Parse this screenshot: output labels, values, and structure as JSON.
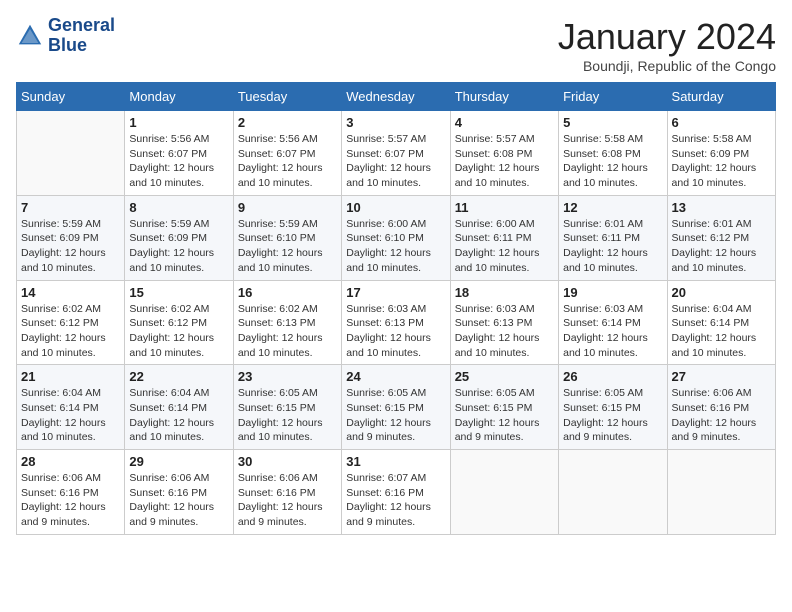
{
  "header": {
    "logo_line1": "General",
    "logo_line2": "Blue",
    "title": "January 2024",
    "subtitle": "Boundji, Republic of the Congo"
  },
  "days_of_week": [
    "Sunday",
    "Monday",
    "Tuesday",
    "Wednesday",
    "Thursday",
    "Friday",
    "Saturday"
  ],
  "weeks": [
    [
      {
        "day": "",
        "sunrise": "",
        "sunset": "",
        "daylight": ""
      },
      {
        "day": "1",
        "sunrise": "Sunrise: 5:56 AM",
        "sunset": "Sunset: 6:07 PM",
        "daylight": "Daylight: 12 hours and 10 minutes."
      },
      {
        "day": "2",
        "sunrise": "Sunrise: 5:56 AM",
        "sunset": "Sunset: 6:07 PM",
        "daylight": "Daylight: 12 hours and 10 minutes."
      },
      {
        "day": "3",
        "sunrise": "Sunrise: 5:57 AM",
        "sunset": "Sunset: 6:07 PM",
        "daylight": "Daylight: 12 hours and 10 minutes."
      },
      {
        "day": "4",
        "sunrise": "Sunrise: 5:57 AM",
        "sunset": "Sunset: 6:08 PM",
        "daylight": "Daylight: 12 hours and 10 minutes."
      },
      {
        "day": "5",
        "sunrise": "Sunrise: 5:58 AM",
        "sunset": "Sunset: 6:08 PM",
        "daylight": "Daylight: 12 hours and 10 minutes."
      },
      {
        "day": "6",
        "sunrise": "Sunrise: 5:58 AM",
        "sunset": "Sunset: 6:09 PM",
        "daylight": "Daylight: 12 hours and 10 minutes."
      }
    ],
    [
      {
        "day": "7",
        "sunrise": "Sunrise: 5:59 AM",
        "sunset": "Sunset: 6:09 PM",
        "daylight": "Daylight: 12 hours and 10 minutes."
      },
      {
        "day": "8",
        "sunrise": "Sunrise: 5:59 AM",
        "sunset": "Sunset: 6:09 PM",
        "daylight": "Daylight: 12 hours and 10 minutes."
      },
      {
        "day": "9",
        "sunrise": "Sunrise: 5:59 AM",
        "sunset": "Sunset: 6:10 PM",
        "daylight": "Daylight: 12 hours and 10 minutes."
      },
      {
        "day": "10",
        "sunrise": "Sunrise: 6:00 AM",
        "sunset": "Sunset: 6:10 PM",
        "daylight": "Daylight: 12 hours and 10 minutes."
      },
      {
        "day": "11",
        "sunrise": "Sunrise: 6:00 AM",
        "sunset": "Sunset: 6:11 PM",
        "daylight": "Daylight: 12 hours and 10 minutes."
      },
      {
        "day": "12",
        "sunrise": "Sunrise: 6:01 AM",
        "sunset": "Sunset: 6:11 PM",
        "daylight": "Daylight: 12 hours and 10 minutes."
      },
      {
        "day": "13",
        "sunrise": "Sunrise: 6:01 AM",
        "sunset": "Sunset: 6:12 PM",
        "daylight": "Daylight: 12 hours and 10 minutes."
      }
    ],
    [
      {
        "day": "14",
        "sunrise": "Sunrise: 6:02 AM",
        "sunset": "Sunset: 6:12 PM",
        "daylight": "Daylight: 12 hours and 10 minutes."
      },
      {
        "day": "15",
        "sunrise": "Sunrise: 6:02 AM",
        "sunset": "Sunset: 6:12 PM",
        "daylight": "Daylight: 12 hours and 10 minutes."
      },
      {
        "day": "16",
        "sunrise": "Sunrise: 6:02 AM",
        "sunset": "Sunset: 6:13 PM",
        "daylight": "Daylight: 12 hours and 10 minutes."
      },
      {
        "day": "17",
        "sunrise": "Sunrise: 6:03 AM",
        "sunset": "Sunset: 6:13 PM",
        "daylight": "Daylight: 12 hours and 10 minutes."
      },
      {
        "day": "18",
        "sunrise": "Sunrise: 6:03 AM",
        "sunset": "Sunset: 6:13 PM",
        "daylight": "Daylight: 12 hours and 10 minutes."
      },
      {
        "day": "19",
        "sunrise": "Sunrise: 6:03 AM",
        "sunset": "Sunset: 6:14 PM",
        "daylight": "Daylight: 12 hours and 10 minutes."
      },
      {
        "day": "20",
        "sunrise": "Sunrise: 6:04 AM",
        "sunset": "Sunset: 6:14 PM",
        "daylight": "Daylight: 12 hours and 10 minutes."
      }
    ],
    [
      {
        "day": "21",
        "sunrise": "Sunrise: 6:04 AM",
        "sunset": "Sunset: 6:14 PM",
        "daylight": "Daylight: 12 hours and 10 minutes."
      },
      {
        "day": "22",
        "sunrise": "Sunrise: 6:04 AM",
        "sunset": "Sunset: 6:14 PM",
        "daylight": "Daylight: 12 hours and 10 minutes."
      },
      {
        "day": "23",
        "sunrise": "Sunrise: 6:05 AM",
        "sunset": "Sunset: 6:15 PM",
        "daylight": "Daylight: 12 hours and 10 minutes."
      },
      {
        "day": "24",
        "sunrise": "Sunrise: 6:05 AM",
        "sunset": "Sunset: 6:15 PM",
        "daylight": "Daylight: 12 hours and 9 minutes."
      },
      {
        "day": "25",
        "sunrise": "Sunrise: 6:05 AM",
        "sunset": "Sunset: 6:15 PM",
        "daylight": "Daylight: 12 hours and 9 minutes."
      },
      {
        "day": "26",
        "sunrise": "Sunrise: 6:05 AM",
        "sunset": "Sunset: 6:15 PM",
        "daylight": "Daylight: 12 hours and 9 minutes."
      },
      {
        "day": "27",
        "sunrise": "Sunrise: 6:06 AM",
        "sunset": "Sunset: 6:16 PM",
        "daylight": "Daylight: 12 hours and 9 minutes."
      }
    ],
    [
      {
        "day": "28",
        "sunrise": "Sunrise: 6:06 AM",
        "sunset": "Sunset: 6:16 PM",
        "daylight": "Daylight: 12 hours and 9 minutes."
      },
      {
        "day": "29",
        "sunrise": "Sunrise: 6:06 AM",
        "sunset": "Sunset: 6:16 PM",
        "daylight": "Daylight: 12 hours and 9 minutes."
      },
      {
        "day": "30",
        "sunrise": "Sunrise: 6:06 AM",
        "sunset": "Sunset: 6:16 PM",
        "daylight": "Daylight: 12 hours and 9 minutes."
      },
      {
        "day": "31",
        "sunrise": "Sunrise: 6:07 AM",
        "sunset": "Sunset: 6:16 PM",
        "daylight": "Daylight: 12 hours and 9 minutes."
      },
      {
        "day": "",
        "sunrise": "",
        "sunset": "",
        "daylight": ""
      },
      {
        "day": "",
        "sunrise": "",
        "sunset": "",
        "daylight": ""
      },
      {
        "day": "",
        "sunrise": "",
        "sunset": "",
        "daylight": ""
      }
    ]
  ]
}
